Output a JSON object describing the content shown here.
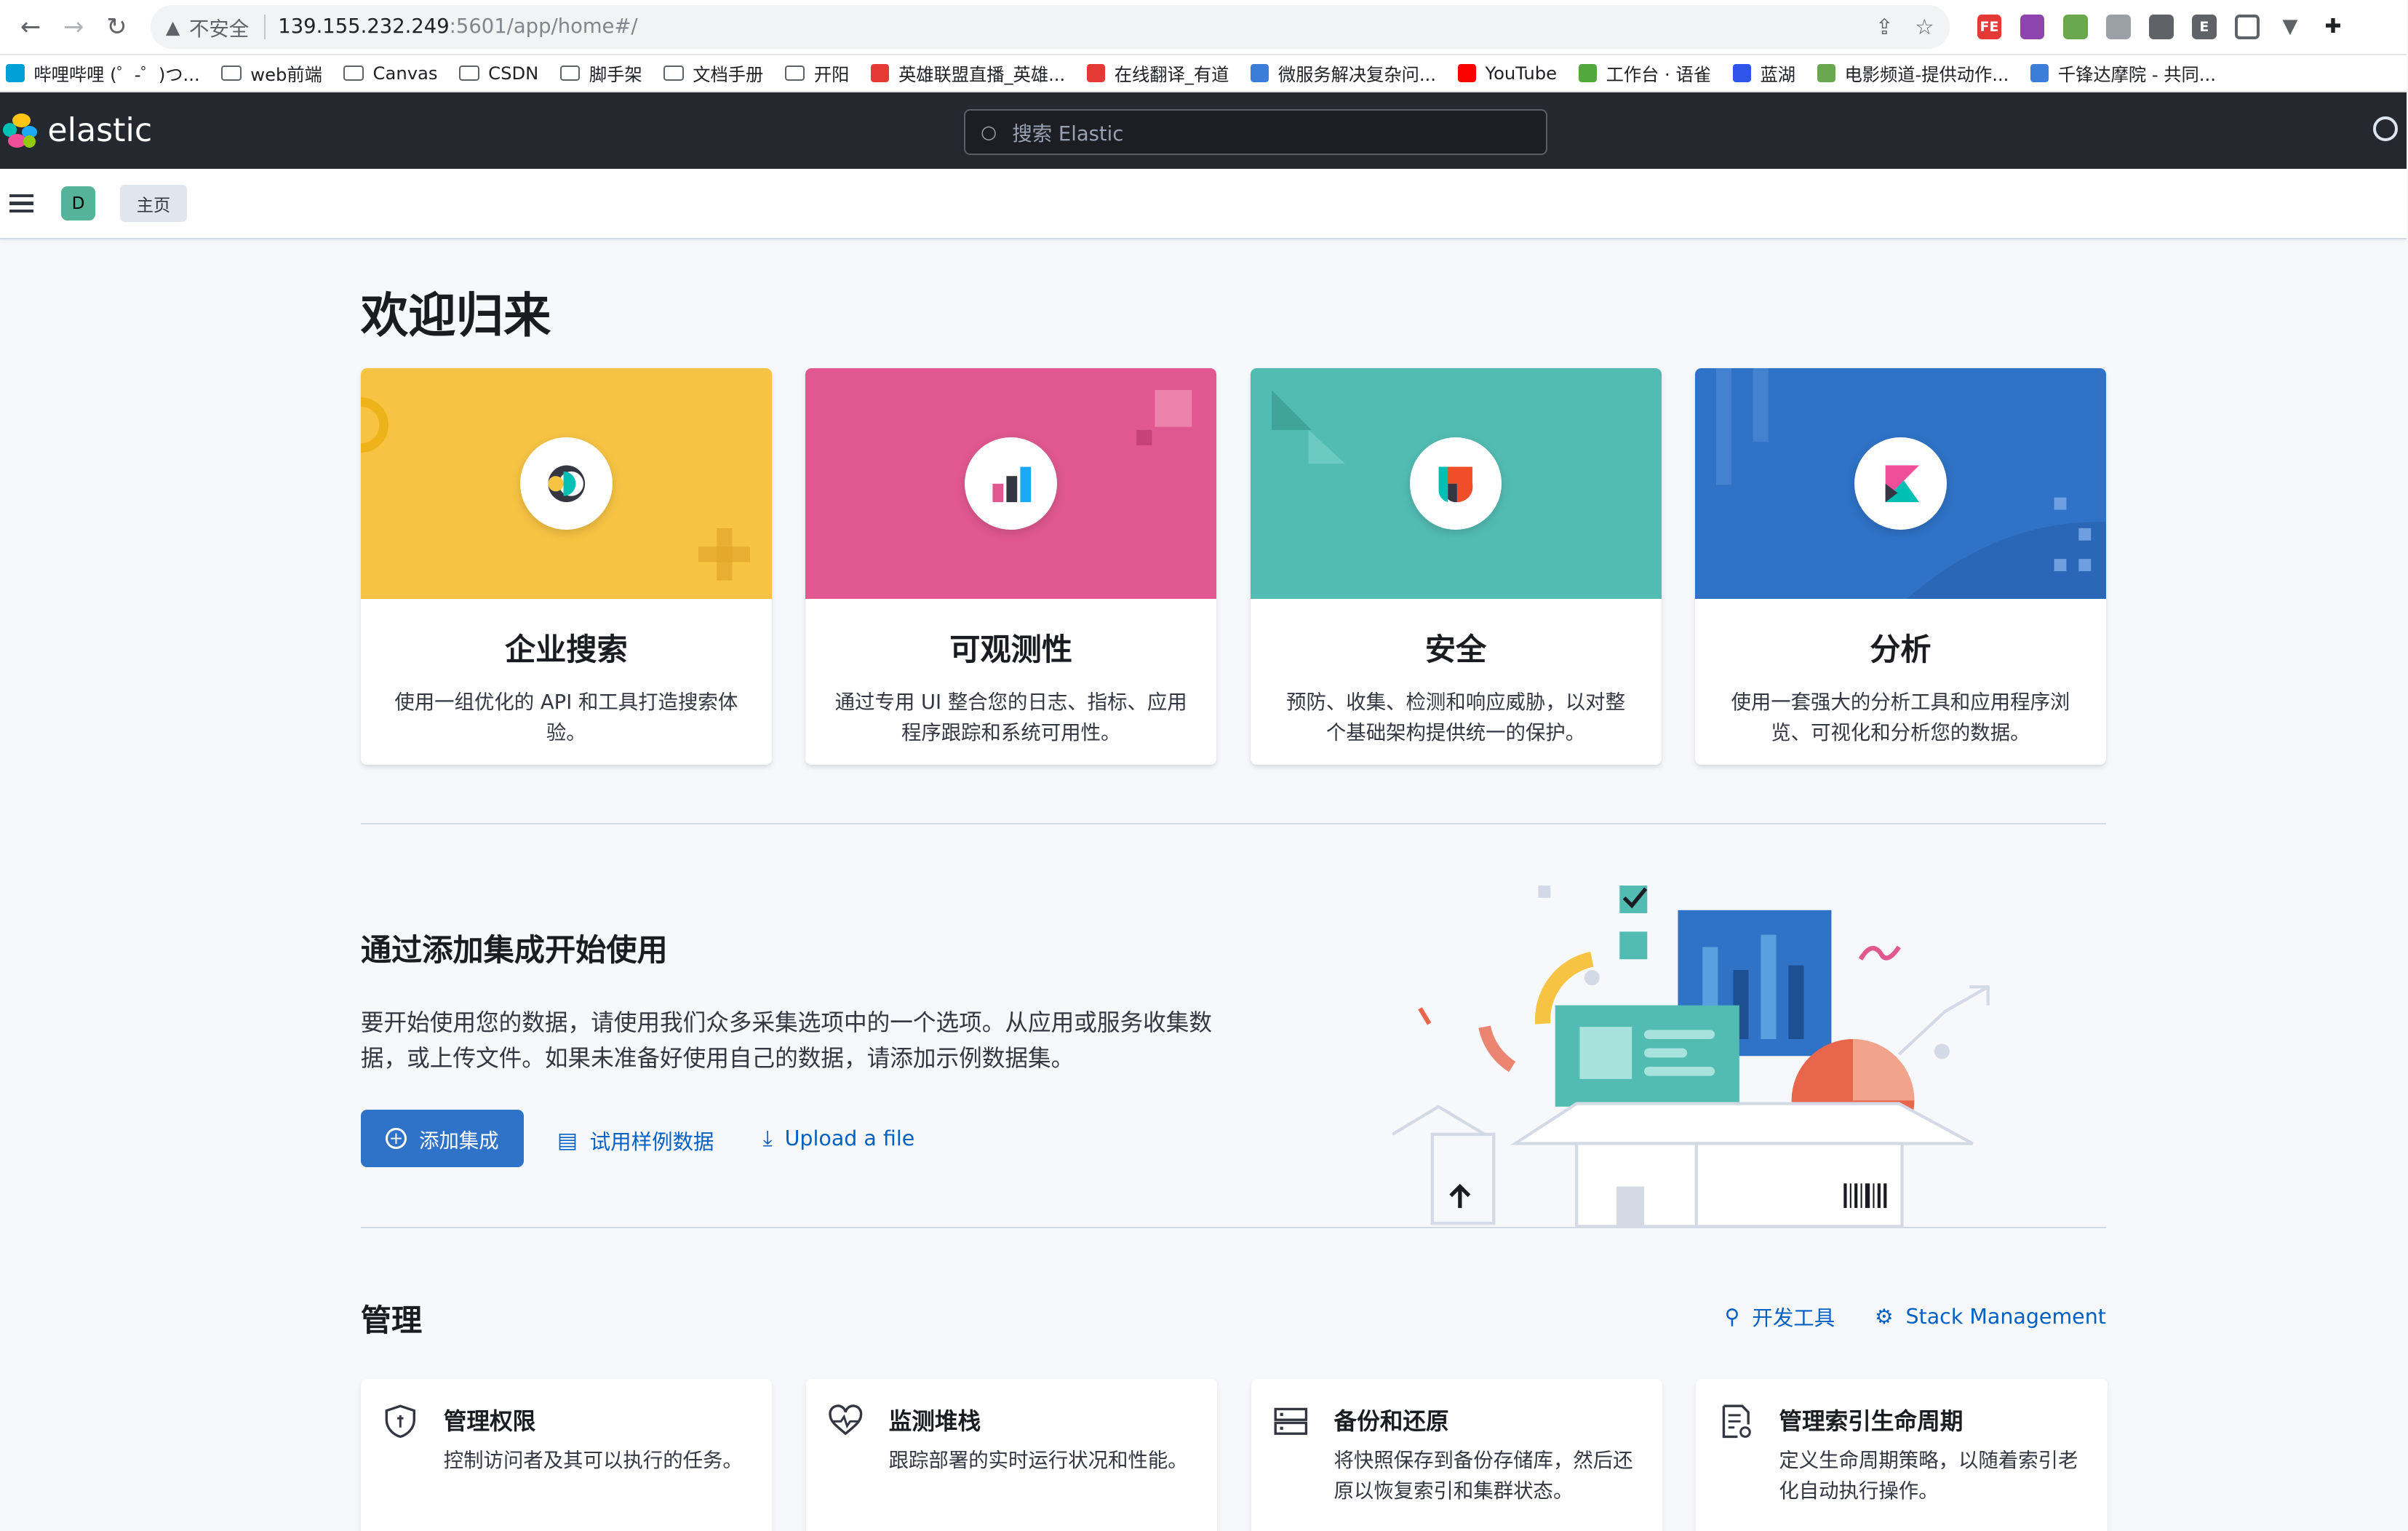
{
  "browser": {
    "security_label": "不安全",
    "url_host": "139.155.232.249",
    "url_path": ":5601/app/home#/"
  },
  "bookmarks": [
    {
      "label": "哔哩哔哩 (゜-゜)つ...",
      "kind": "site"
    },
    {
      "label": "web前端",
      "kind": "folder"
    },
    {
      "label": "Canvas",
      "kind": "folder"
    },
    {
      "label": "CSDN",
      "kind": "folder"
    },
    {
      "label": "脚手架",
      "kind": "folder"
    },
    {
      "label": "文档手册",
      "kind": "folder"
    },
    {
      "label": "开阳",
      "kind": "folder"
    },
    {
      "label": "英雄联盟直播_英雄...",
      "kind": "site"
    },
    {
      "label": "在线翻译_有道",
      "kind": "site"
    },
    {
      "label": "微服务解决复杂问...",
      "kind": "site"
    },
    {
      "label": "YouTube",
      "kind": "site"
    },
    {
      "label": "工作台 · 语雀",
      "kind": "site"
    },
    {
      "label": "蓝湖",
      "kind": "site"
    },
    {
      "label": "电影频道-提供动作...",
      "kind": "site"
    },
    {
      "label": "千锋达摩院 - 共同...",
      "kind": "site"
    }
  ],
  "header": {
    "logo_text": "elastic",
    "search_placeholder": "搜索 Elastic"
  },
  "subheader": {
    "space_initial": "D",
    "breadcrumb": "主页"
  },
  "welcome_title": "欢迎归来",
  "solutions": [
    {
      "title": "企业搜索",
      "desc": "使用一组优化的 API 和工具打造搜索体验。",
      "color": "#f6c343"
    },
    {
      "title": "可观测性",
      "desc": "通过专用 UI 整合您的日志、指标、应用程序跟踪和系统可用性。",
      "color": "#e0588f"
    },
    {
      "title": "安全",
      "desc": "预防、收集、检测和响应威胁，以对整个基础架构提供统一的保护。",
      "color": "#52bcb3"
    },
    {
      "title": "分析",
      "desc": "使用一套强大的分析工具和应用程序浏览、可视化和分析您的数据。",
      "color": "#2f72c6"
    }
  ],
  "integrations": {
    "title": "通过添加集成开始使用",
    "desc": "要开始使用您的数据，请使用我们众多采集选项中的一个选项。从应用或服务收集数据，或上传文件。如果未准备好使用自己的数据，请添加示例数据集。",
    "add_button": "添加集成",
    "sample_link": "试用样例数据",
    "upload_link": "Upload a file"
  },
  "management": {
    "title": "管理",
    "dev_tools": "开发工具",
    "stack_management": "Stack Management",
    "cards": [
      {
        "title": "管理权限",
        "desc": "控制访问者及其可以执行的任务。",
        "icon": "shield-icon"
      },
      {
        "title": "监测堆栈",
        "desc": "跟踪部署的实时运行状况和性能。",
        "icon": "heart-pulse-icon"
      },
      {
        "title": "备份和还原",
        "desc": "将快照保存到备份存储库，然后还原以恢复索引和集群状态。",
        "icon": "storage-icon"
      },
      {
        "title": "管理索引生命周期",
        "desc": "定义生命周期策略，以随着索引老化自动执行操作。",
        "icon": "document-gear-icon"
      }
    ]
  }
}
